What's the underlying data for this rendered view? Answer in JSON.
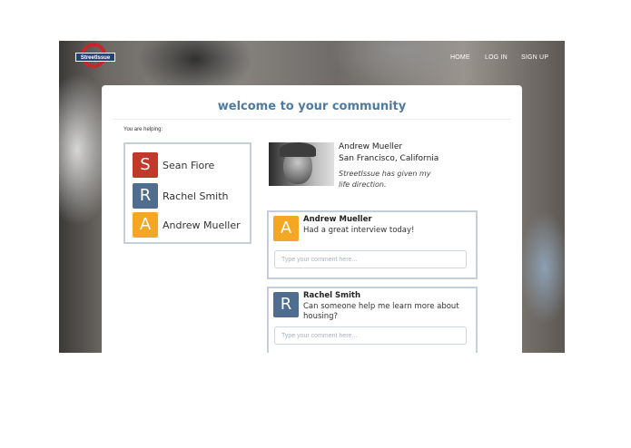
{
  "brand": {
    "name": "StreetIssue"
  },
  "nav": {
    "home": "HOME",
    "login": "LOG IN",
    "signup": "SIGN UP"
  },
  "panel": {
    "title": "welcome to your community",
    "helping_label": "You are helping:"
  },
  "helping": [
    {
      "initial": "S",
      "name": "Sean Fiore",
      "color": "#c0392b"
    },
    {
      "initial": "R",
      "name": "Rachel Smith",
      "color": "#4f6d8f"
    },
    {
      "initial": "A",
      "name": "Andrew Mueller",
      "color": "#f5a623"
    }
  ],
  "profile": {
    "name": "Andrew Mueller",
    "location": "San Francisco, California",
    "quote": "StreetIssue has given my life direction."
  },
  "posts": [
    {
      "initial": "A",
      "color": "#f5a623",
      "author": "Andrew Mueller",
      "text": "Had a great interview today!",
      "comment_placeholder": "Type your comment here..."
    },
    {
      "initial": "R",
      "color": "#4f6d8f",
      "author": "Rachel Smith",
      "text": "Can someone help me learn more about housing?",
      "comment_placeholder": "Type your comment here..."
    }
  ]
}
